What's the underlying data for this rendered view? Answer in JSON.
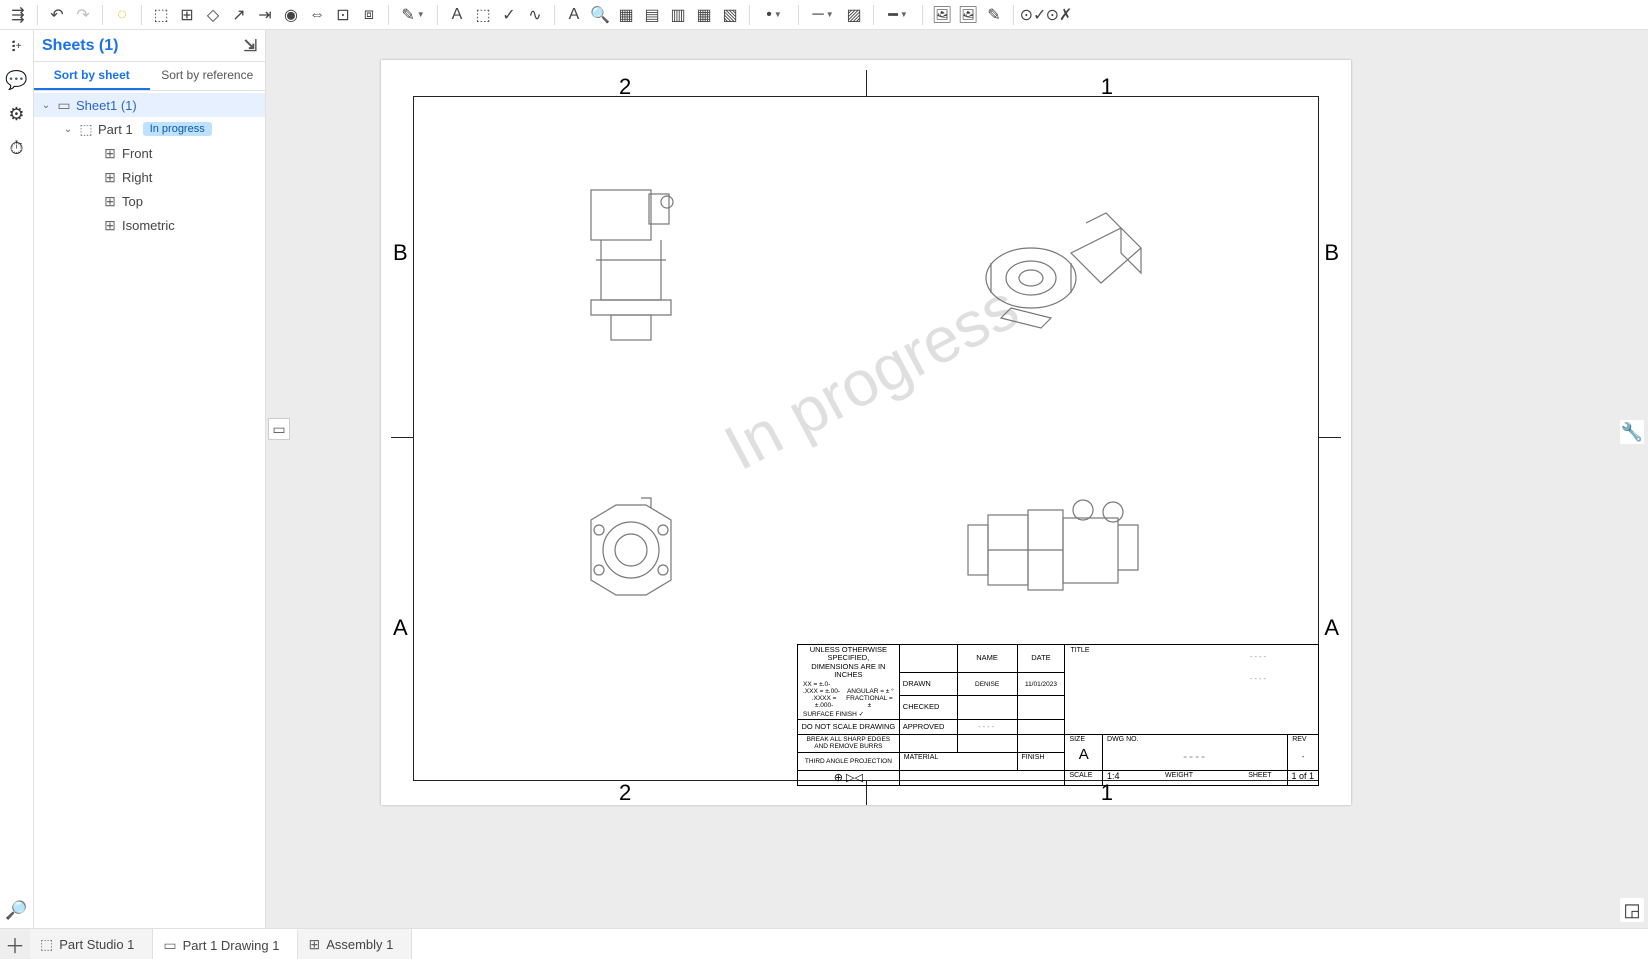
{
  "toolbar": {
    "undo": "↶",
    "redo": "↷",
    "featurescript": "◌",
    "insert_view": "⬚",
    "four_view": "⊞",
    "projected": "◇",
    "aux": "↗",
    "section": "⇥",
    "detail": "◉",
    "break": "⇔",
    "broken_out": "⊡",
    "crop": "⧈",
    "sketch": "✎",
    "note": "A",
    "note_leader": "⬚",
    "check": "✓",
    "spline": "∿",
    "text": "A",
    "find": "🔍",
    "table": "▦",
    "bom": "▤",
    "import": "▥",
    "export": "▦",
    "pdf": "▧",
    "point": "•",
    "line": "─",
    "hatch": "▨",
    "image": "🖼",
    "image2": "🖼",
    "pencil": "✎",
    "inspect": "⊙✓",
    "clear": "⊙✗"
  },
  "left_gutter": {
    "tree": "⇶",
    "add": "⊕",
    "comment": "💬",
    "config": "⚙",
    "timer": "⏱",
    "search": "🔍"
  },
  "panel": {
    "title": "Sheets (1)",
    "export": "⇲",
    "sort_sheet": "Sort by sheet",
    "sort_ref": "Sort by reference"
  },
  "tree": {
    "sheet": "Sheet1 (1)",
    "part": "Part 1",
    "badge": "In progress",
    "views": {
      "front": "Front",
      "right": "Right",
      "top": "Top",
      "iso": "Isometric"
    }
  },
  "watermark": "In progress",
  "zones": {
    "c1": "1",
    "c2": "2",
    "rA": "A",
    "rB": "B"
  },
  "titleblock": {
    "spec1": "UNLESS OTHERWISE SPECIFIED,",
    "spec2": "DIMENSIONS ARE IN INCHES",
    "tol_x": "XX = ±.0-",
    "tol_xxx": ".XXX = ±.00-",
    "tol_xxxx": ".XXXX = ±.000-",
    "tol_ang": "ANGULAR = ± °",
    "tol_frac": "FRACTIONAL = ±",
    "surface": "SURFACE FINISH",
    "noscale": "DO NOT SCALE DRAWING",
    "edges": "BREAK ALL SHARP EDGES AND REMOVE BURRS",
    "proj": "THIRD ANGLE PROJECTION",
    "name_h": "NAME",
    "date_h": "DATE",
    "drawn": "DRAWN",
    "drawn_name": "DENISE",
    "drawn_date": "11/01/2023",
    "checked": "CHECKED",
    "approved": "APPROVED",
    "material": "MATERIAL",
    "finish": "FINISH",
    "title": "TITLE",
    "size": "SIZE",
    "size_v": "A",
    "dwg": "DWG NO.",
    "rev": "REV",
    "scale": "SCALE",
    "scale_v": "1:4",
    "weight": "WEIGHT",
    "sheet": "SHEET",
    "sheet_v": "1 of 1",
    "dash": "----"
  },
  "tabs": {
    "part_studio": "Part Studio 1",
    "drawing": "Part 1 Drawing 1",
    "assembly": "Assembly 1"
  },
  "right_tools": {
    "wrench": "🔧",
    "iso": "⬚"
  }
}
